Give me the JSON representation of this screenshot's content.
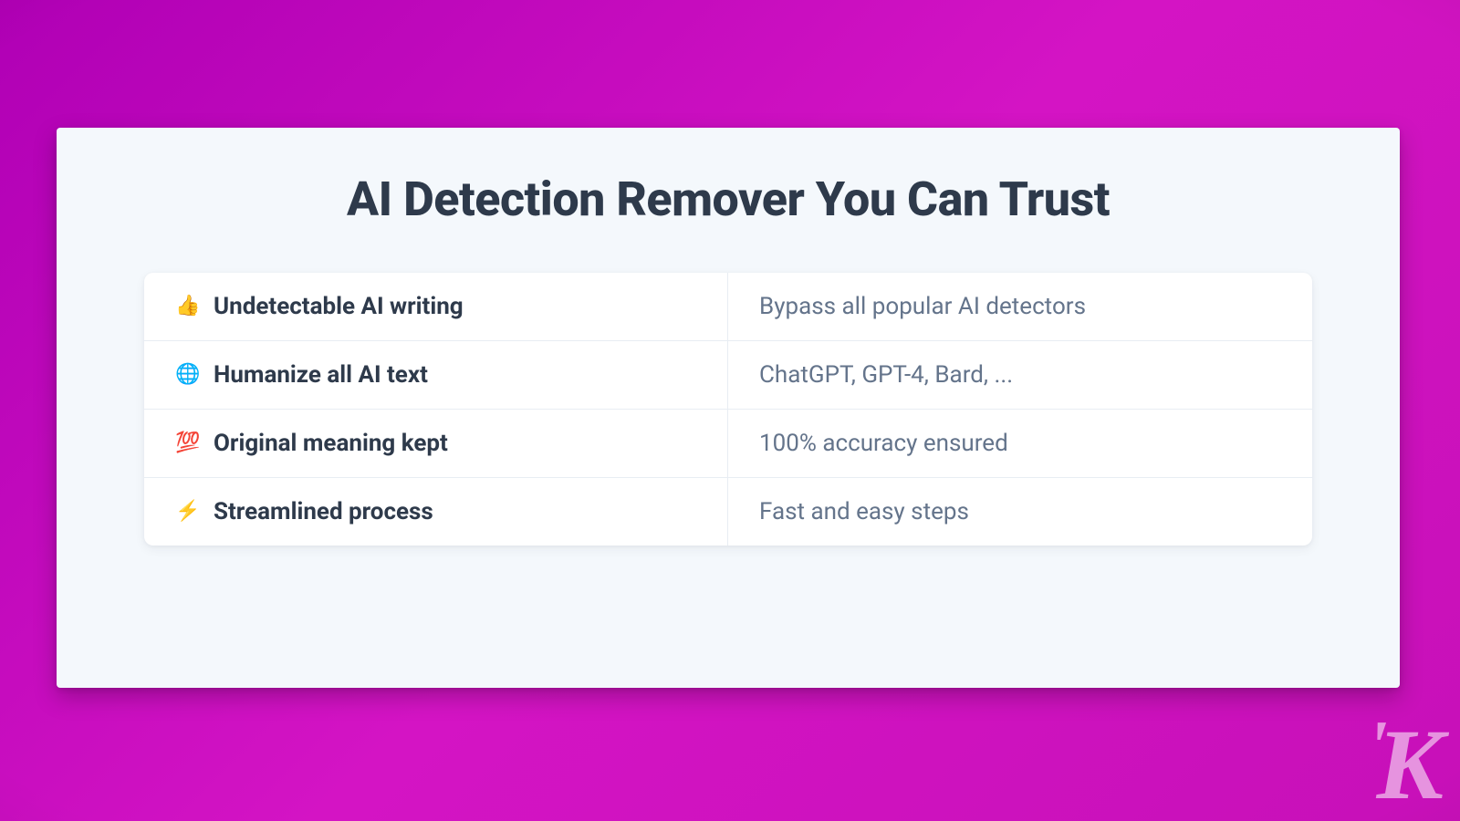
{
  "heading": "AI Detection Remover You Can Trust",
  "features": [
    {
      "icon": "👍",
      "label": "Undetectable AI writing",
      "desc": "Bypass all popular AI detectors"
    },
    {
      "icon": "🌐",
      "label": "Humanize all AI text",
      "desc": "ChatGPT, GPT-4, Bard, ..."
    },
    {
      "icon": "💯",
      "label": "Original meaning kept",
      "desc": "100% accuracy ensured"
    },
    {
      "icon": "⚡",
      "label": "Streamlined process",
      "desc": "Fast and easy steps"
    }
  ],
  "watermark": "K"
}
